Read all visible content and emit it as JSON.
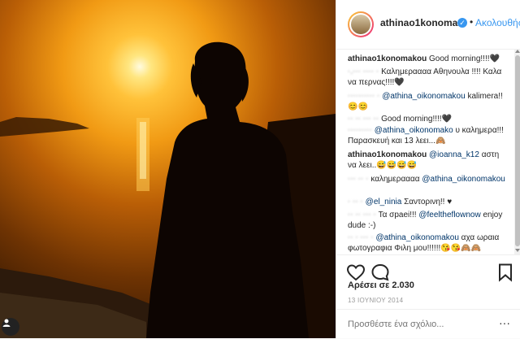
{
  "header": {
    "username": "athinao1konoma...",
    "verified_glyph": "✓",
    "separator": "•",
    "follow_label": "Ακολουθήστε"
  },
  "comments": [
    {
      "user": "athinao1konomakou",
      "text": "Good morning!!!!🖤"
    },
    {
      "user": "·.··· ···· ·",
      "text": "Καλημεραααα Αθηνουλα !!!! Καλα να περνας!!!!🖤"
    },
    {
      "user": "·········· ·",
      "mention": "@athina_oikonomakou",
      "text": "kalimera!! 😊😊"
    },
    {
      "user": "·· ·· ··· ··",
      "text": "Good morning!!!!🖤"
    },
    {
      "user": "·········",
      "mention": "@athina_oikonomako",
      "text": "υ καλημερα!!! Παρασκευή και 13 λεει...🙈"
    },
    {
      "user": "athinao1konomakou",
      "mention": "@ioanna_k12",
      "text": "αστη να λεει..😅😅😅😅"
    },
    {
      "user": "··· ·· ·",
      "text": "καλημεραααα",
      "mention2": "@athina_oikonomakou"
    },
    {
      "user": "· ·· ·",
      "mention": "@el_ninia",
      "text": "Σαντορινη!! ♥"
    },
    {
      "user": "·· ·· ··· ·",
      "text": "Τα σpaei!!!",
      "mention2": "@feeltheflownow",
      "text2": "enjoy dude :-)"
    },
    {
      "user": "·· · ··· ·",
      "mention": "@athina_oikonomakou",
      "text": "αχα ωραια φωτογραφια Φιλη μου!!!!!!😘😘🙈🙈"
    }
  ],
  "stats": {
    "likes": "Αρέσει σε 2.030",
    "date": "13 ΙΟΥΝΙΟΥ 2014"
  },
  "add_comment": {
    "placeholder": "Προσθέστε ένα σχόλιο...",
    "more_glyph": "···"
  },
  "colors": {
    "accent": "#3897f0",
    "mention": "#003569",
    "sun": "#ffc23a"
  },
  "icons": [
    "heart-icon",
    "comment-icon",
    "bookmark-icon",
    "verified-icon",
    "more-options-icon"
  ]
}
